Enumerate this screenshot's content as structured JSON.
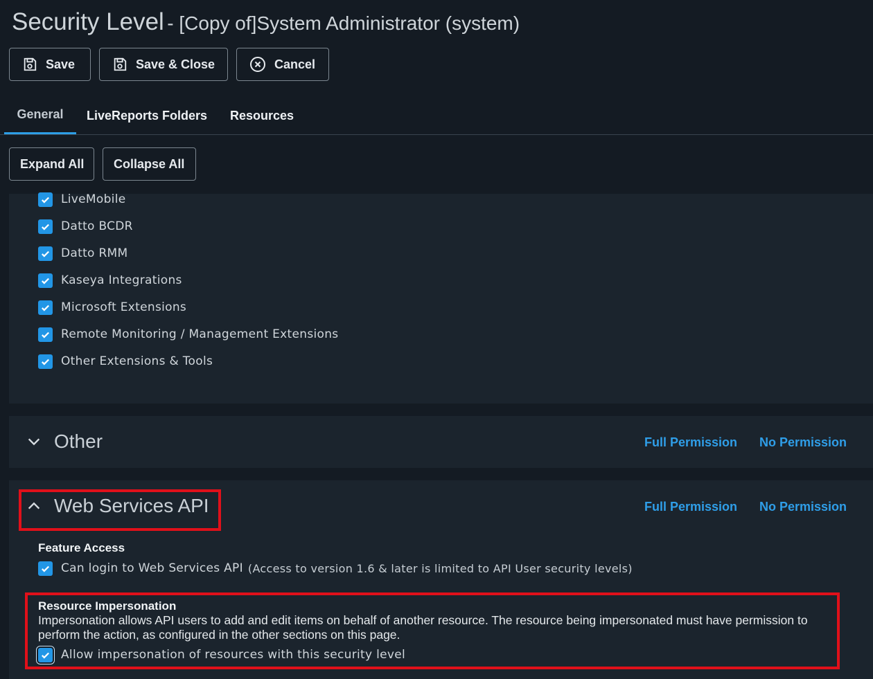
{
  "header": {
    "title": "Security Level",
    "subtitle": "- [Copy of]System Administrator (system)"
  },
  "toolbar": {
    "save_label": "Save",
    "save_close_label": "Save & Close",
    "cancel_label": "Cancel"
  },
  "tabs": [
    {
      "label": "General",
      "active": true
    },
    {
      "label": "LiveReports Folders",
      "active": false
    },
    {
      "label": "Resources",
      "active": false
    }
  ],
  "tree_controls": {
    "expand_all": "Expand All",
    "collapse_all": "Collapse All"
  },
  "extensions": {
    "items": [
      {
        "label": "LiveMobile",
        "checked": true
      },
      {
        "label": "Datto BCDR",
        "checked": true
      },
      {
        "label": "Datto RMM",
        "checked": true
      },
      {
        "label": "Kaseya Integrations",
        "checked": true
      },
      {
        "label": "Microsoft Extensions",
        "checked": true
      },
      {
        "label": "Remote Monitoring / Management Extensions",
        "checked": true
      },
      {
        "label": "Other Extensions & Tools",
        "checked": true
      }
    ]
  },
  "sections": {
    "other": {
      "title": "Other",
      "expanded": false,
      "full_permission": "Full Permission",
      "no_permission": "No Permission"
    },
    "web_services": {
      "title": "Web Services API",
      "expanded": true,
      "full_permission": "Full Permission",
      "no_permission": "No Permission",
      "feature_access": {
        "heading": "Feature Access",
        "login_label": "Can login to Web Services API",
        "login_note": "(Access to version 1.6 & later is limited to API User security levels)",
        "login_checked": true
      },
      "impersonation": {
        "heading": "Resource Impersonation",
        "description": "Impersonation allows API users to add and edit items on behalf of another resource. The resource being impersonated must have permission to perform the action, as configured in the other sections on this page.",
        "allow_label": "Allow impersonation of resources with this security level",
        "allow_checked": true
      }
    }
  },
  "colors": {
    "background": "#141b23",
    "panel": "#1b242d",
    "accent": "#2296e6",
    "link": "#2f9ee8",
    "highlight": "#e0101a"
  }
}
